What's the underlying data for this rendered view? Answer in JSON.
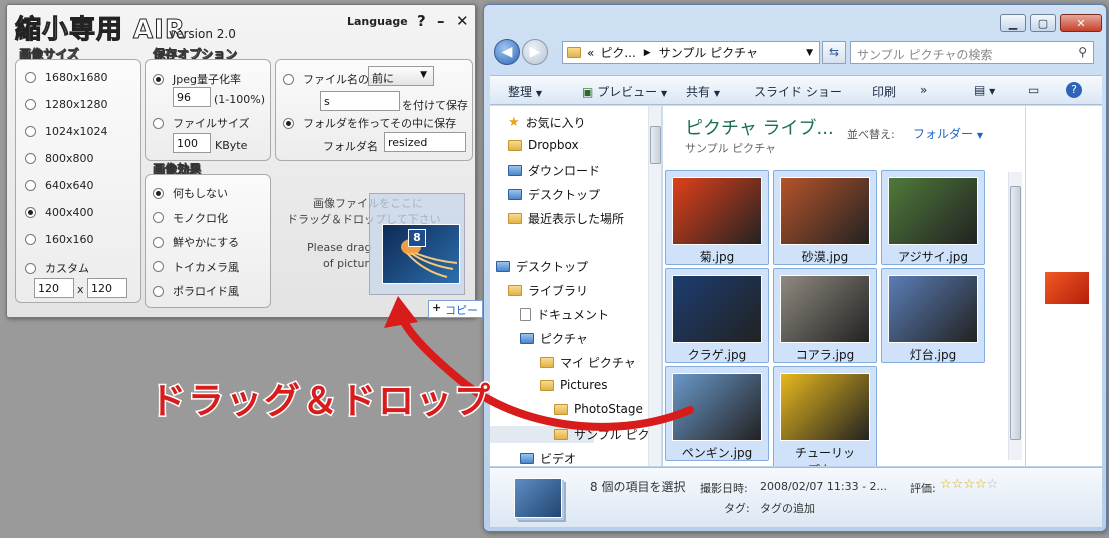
{
  "air": {
    "title": "縮小専用 AIR",
    "version": "version 2.0",
    "language": "Language",
    "help": "?",
    "minimize": "–",
    "close": "✕",
    "size_group": {
      "label": "画像サイズ",
      "options": [
        "1680x1680",
        "1280x1280",
        "1024x1024",
        "800x800",
        "640x640",
        "400x400",
        "160x160",
        "カスタム"
      ],
      "selected_index": 5,
      "custom_w": "120",
      "custom_x": "x",
      "custom_h": "120"
    },
    "save_group": {
      "label": "保存オプション",
      "jpeg_label": "Jpeg量子化率",
      "jpeg_value": "96",
      "jpeg_range": "(1-100%)",
      "filesize_label": "ファイルサイズ",
      "filesize_value": "100",
      "filesize_unit": "KByte"
    },
    "name_group": {
      "filename_label": "ファイル名の",
      "position_value": "前に",
      "suffix_value": "s",
      "suffix_label": "を付けて保存",
      "folder_label": "フォルダを作ってその中に保存",
      "foldername_label": "フォルダ名",
      "foldername_value": "resized"
    },
    "effect_group": {
      "label": "画像効果",
      "options": [
        "何もしない",
        "モノクロ化",
        "鮮やかにする",
        "トイカメラ風",
        "ポラロイド風"
      ],
      "selected_index": 0
    },
    "dropzone": {
      "line1": "画像ファイルをここに",
      "line2": "ドラッグ＆ドロップして下さい",
      "line3": "Please drag",
      "line4": "of pictur",
      "count": "8"
    }
  },
  "explorer": {
    "address_prefix": "«",
    "address_parts": [
      "ピク...",
      "サンプル ピクチャ"
    ],
    "search_placeholder": "サンプル ピクチャの検索",
    "toolbar": {
      "organize": "整理",
      "preview": "プレビュー",
      "share": "共有",
      "slideshow": "スライド ショー",
      "print": "印刷",
      "more": "»"
    },
    "nav_items": [
      "お気に入り",
      "Dropbox",
      "ダウンロード",
      "デスクトップ",
      "最近表示した場所",
      "デスクトップ",
      "ライブラリ",
      "ドキュメント",
      "ピクチャ",
      "マイ ピクチャ",
      "Pictures",
      "PhotoStage",
      "サンプル ピク",
      "ビデオ"
    ],
    "library_title": "ピクチャ ライブ...",
    "library_sub": "サンプル ピクチャ",
    "sort_label": "並べ替え:",
    "sort_value": "フォルダー",
    "thumbnails": [
      {
        "name": "菊.jpg",
        "color": "#e0401a"
      },
      {
        "name": "砂漠.jpg",
        "color": "#b5532a"
      },
      {
        "name": "アジサイ.jpg",
        "color": "#4f7a3a"
      },
      {
        "name": "クラゲ.jpg",
        "color": "#1c3d70"
      },
      {
        "name": "コアラ.jpg",
        "color": "#8f8a80"
      },
      {
        "name": "灯台.jpg",
        "color": "#5a7db5"
      },
      {
        "name": "ペンギン.jpg",
        "color": "#6a98c9"
      },
      {
        "name": "チューリップ.jpg",
        "color": "#e6b81c"
      }
    ],
    "details": {
      "selected": "8 個の項目を選択",
      "date_label": "撮影日時:",
      "date_value": "2008/02/07 11:33 - 2...",
      "rating_label": "評価:",
      "tag_label": "タグ:",
      "tag_value": "タグの追加"
    },
    "rating": {
      "filled": 4,
      "total": 5
    }
  },
  "overlay": {
    "copy_badge": "コピー",
    "drag_label": "ドラッグ＆ドロップ",
    "arrow_color": "#d81b1b"
  }
}
